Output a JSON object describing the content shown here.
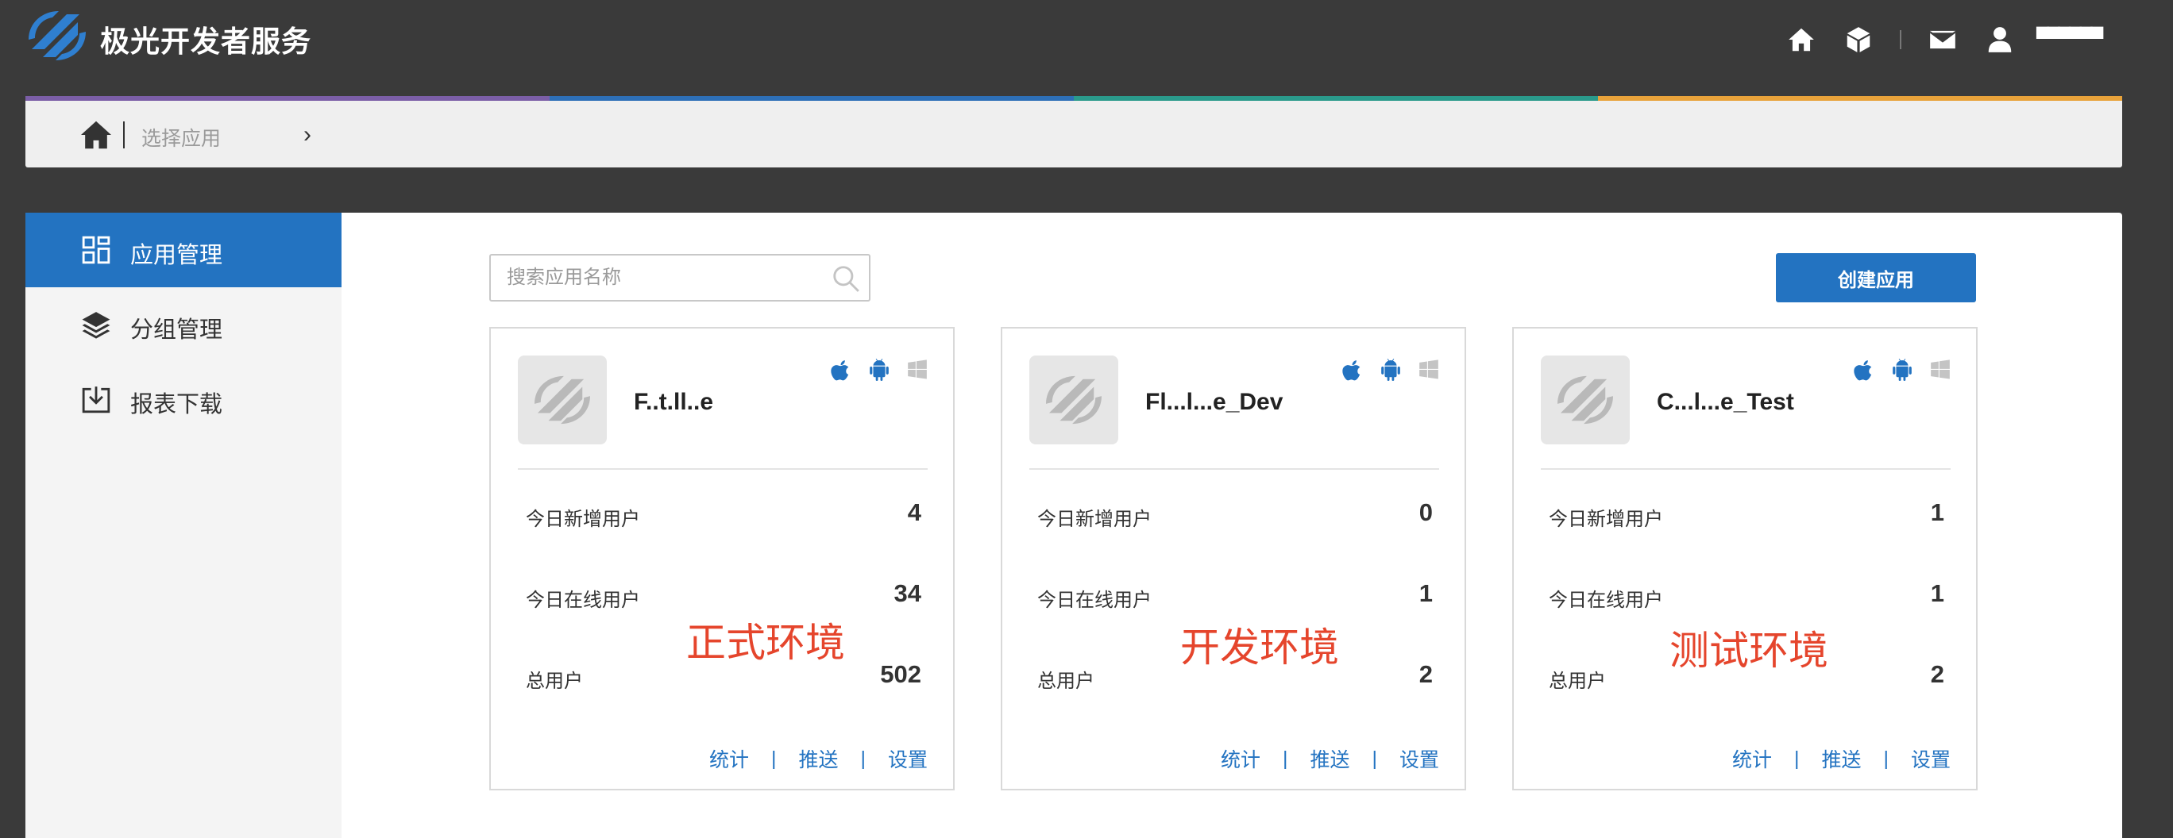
{
  "header": {
    "brand": "极光开发者服务",
    "username": "▀▀▀▀▀▀",
    "icons": [
      "home-icon",
      "cube-icon",
      "mail-icon",
      "user-icon"
    ]
  },
  "colors": {
    "topbar": "#3a3a3a",
    "accent": "#2373c1",
    "strip": [
      "#7b5ea7",
      "#2d6fb7",
      "#2a9a8b",
      "#e8a23a"
    ],
    "annotation": "#e5452c"
  },
  "breadcrumb": {
    "text": "选择应用"
  },
  "sidebar": {
    "items": [
      {
        "label": "应用管理",
        "icon": "grid-icon",
        "active": true
      },
      {
        "label": "分组管理",
        "icon": "layers-icon",
        "active": false
      },
      {
        "label": "报表下载",
        "icon": "download-icon",
        "active": false
      }
    ]
  },
  "search": {
    "placeholder": "搜索应用名称"
  },
  "create_button": "创建应用",
  "stat_labels": {
    "new": "今日新增用户",
    "online": "今日在线用户",
    "total": "总用户"
  },
  "links": {
    "stats": "统计",
    "push": "推送",
    "settings": "设置",
    "sep": "|"
  },
  "cards": [
    {
      "name": "F..t.ll..e",
      "new": "4",
      "online": "34",
      "total": "502",
      "annotation": "正式环境"
    },
    {
      "name": "Fl...l...e_Dev",
      "new": "0",
      "online": "1",
      "total": "2",
      "annotation": "开发环境"
    },
    {
      "name": "C...l...e_Test",
      "new": "1",
      "online": "1",
      "total": "2",
      "annotation": "测试环境"
    }
  ]
}
